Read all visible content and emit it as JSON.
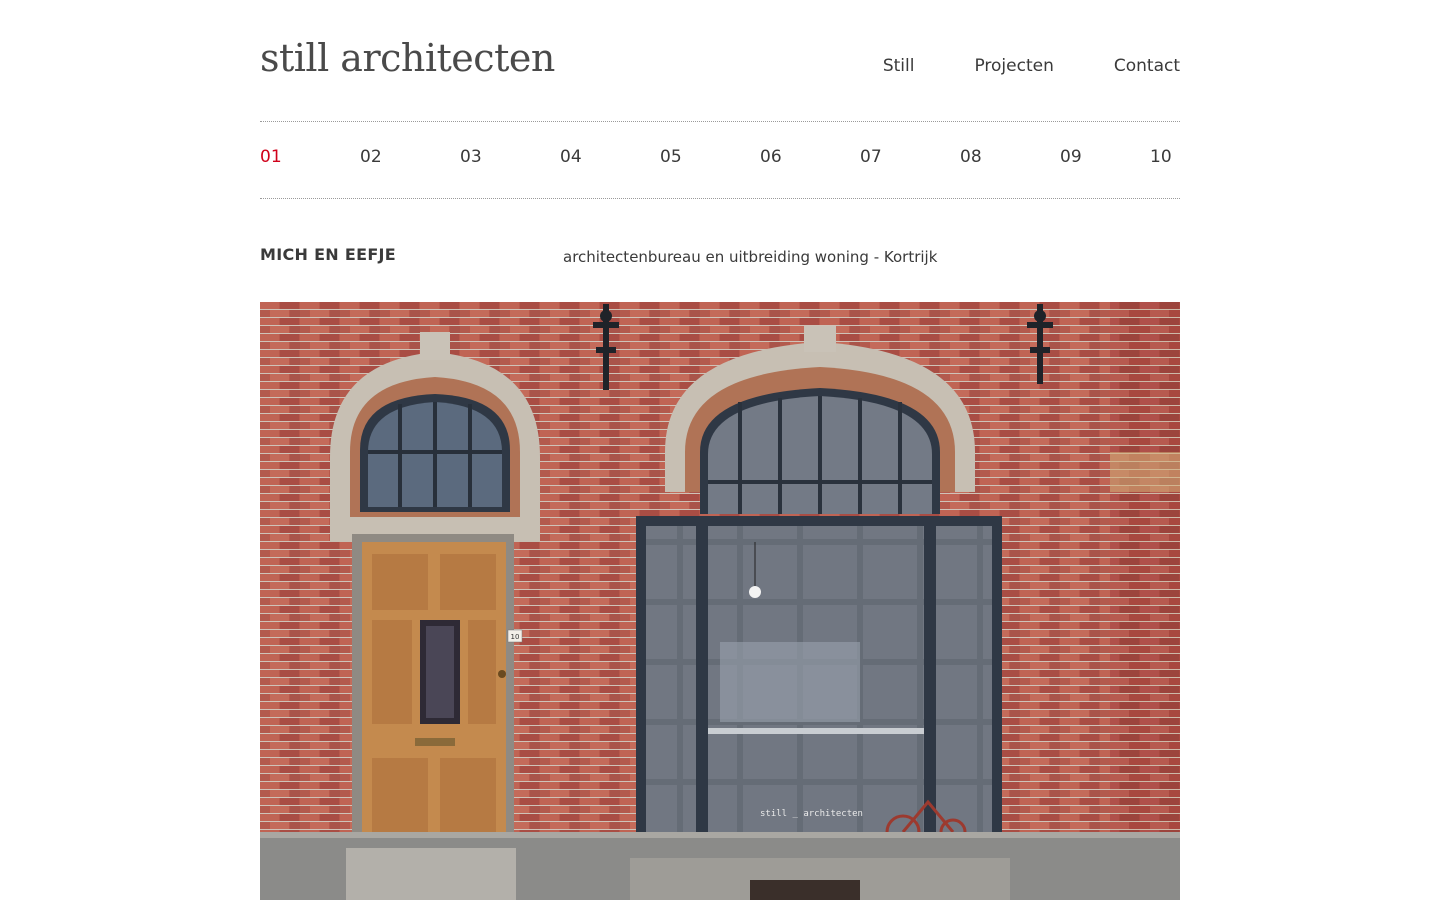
{
  "site": {
    "logo": "still architecten"
  },
  "nav": {
    "items": [
      "Still",
      "Projecten",
      "Contact"
    ]
  },
  "pager": {
    "active": "01",
    "items": [
      "01",
      "02",
      "03",
      "04",
      "05",
      "06",
      "07",
      "08",
      "09",
      "10"
    ]
  },
  "project": {
    "title": "MICH EN EEFJE",
    "subtitle": "architectenbureau en uitbreiding woning - Kortrijk",
    "door_number": "10",
    "window_lettering": "still _ architecten"
  },
  "colors": {
    "accent": "#d0021b",
    "text": "#3a3a3a",
    "brick": "#b5554a",
    "frame": "#3b4656",
    "door": "#c48a4e"
  }
}
